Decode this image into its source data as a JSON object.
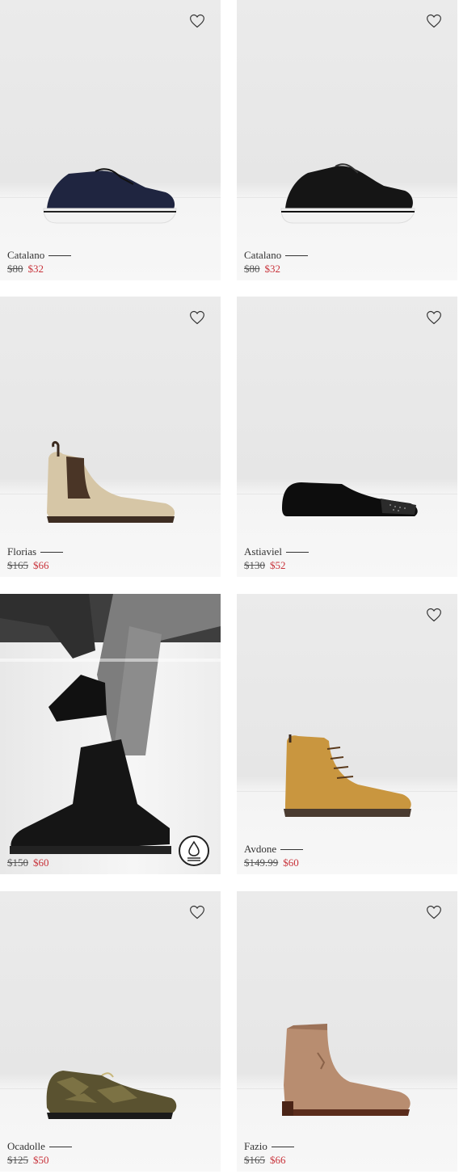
{
  "products": [
    {
      "name": "Catalano",
      "original_price": "$80",
      "sale_price": "$32",
      "color": "navy sneaker"
    },
    {
      "name": "Catalano",
      "original_price": "$80",
      "sale_price": "$32",
      "color": "black sneaker"
    },
    {
      "name": "Florias",
      "original_price": "$165",
      "sale_price": "$66",
      "color": "beige chelsea boot"
    },
    {
      "name": "Astiaviel",
      "original_price": "$130",
      "sale_price": "$52",
      "color": "black loafer"
    },
    {
      "name": "",
      "original_price": "$150",
      "sale_price": "$60",
      "color": "black lace-up boot lifestyle"
    },
    {
      "name": "Avdone",
      "original_price": "$149.99",
      "sale_price": "$60",
      "color": "tan lace-up boot"
    },
    {
      "name": "Ocadolle",
      "original_price": "$125",
      "sale_price": "$50",
      "color": "camo loafer"
    },
    {
      "name": "Fazio",
      "original_price": "$165",
      "sale_price": "$66",
      "color": "suede western boot"
    }
  ],
  "icons": {
    "favorite": "heart-icon",
    "water_resistant": "water-drop-icon"
  },
  "colors": {
    "sale": "#c8323a",
    "text": "#333333"
  }
}
